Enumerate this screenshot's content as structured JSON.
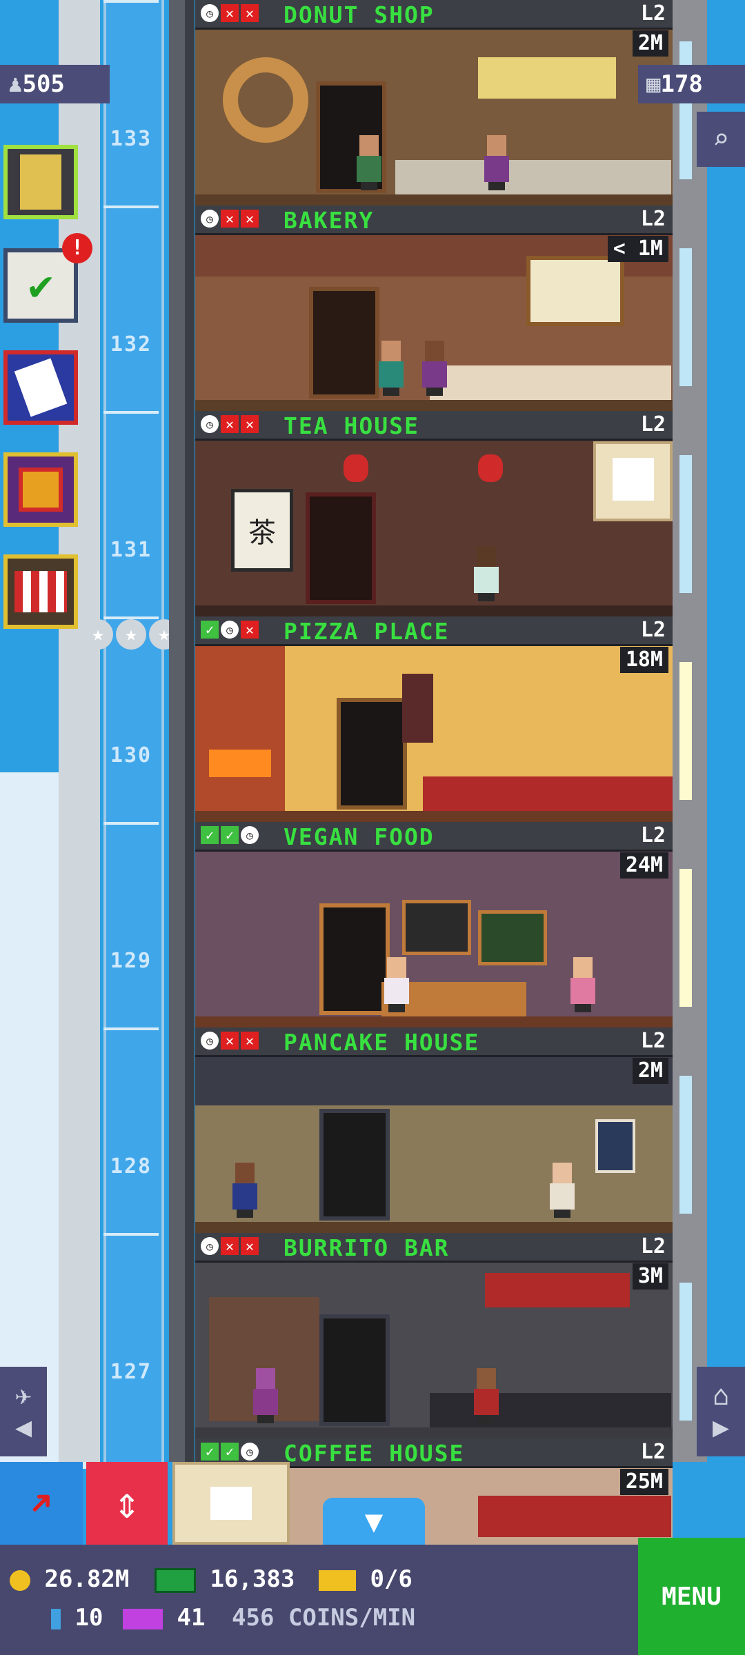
{
  "hud": {
    "population": "505",
    "bux_floors": "178"
  },
  "floors": [
    {
      "name": "DONUT SHOP",
      "level": "L2",
      "price": "2M",
      "status": [
        "clock",
        "x",
        "x"
      ]
    },
    {
      "name": "BAKERY",
      "level": "L2",
      "price": "< 1M",
      "status": [
        "clock",
        "x",
        "x"
      ]
    },
    {
      "name": "TEA HOUSE",
      "level": "L2",
      "price": "",
      "status": [
        "clock",
        "x",
        "x"
      ],
      "sign": "茶"
    },
    {
      "name": "PIZZA PLACE",
      "level": "L2",
      "price": "18M",
      "status": [
        "check",
        "clock",
        "x"
      ]
    },
    {
      "name": "VEGAN FOOD",
      "level": "L2",
      "price": "24M",
      "status": [
        "check",
        "check",
        "clock"
      ]
    },
    {
      "name": "PANCAKE HOUSE",
      "level": "L2",
      "price": "2M",
      "status": [
        "clock",
        "x",
        "x"
      ]
    },
    {
      "name": "BURRITO BAR",
      "level": "L2",
      "price": "3M",
      "status": [
        "clock",
        "x",
        "x"
      ]
    },
    {
      "name": "COFFEE HOUSE",
      "level": "L2",
      "price": "25M",
      "status": [
        "check",
        "check",
        "clock"
      ]
    }
  ],
  "shaft_numbers": [
    "133",
    "132",
    "131",
    "130",
    "129",
    "128",
    "127"
  ],
  "stats": {
    "coins": "26.82M",
    "bux": "16,383",
    "tickets": "0/6",
    "keys": "10",
    "vip": "41",
    "rate": "456 COINS/MIN"
  },
  "menu_label": "MENU",
  "notification_badge": "!",
  "colors": {
    "accent_green": "#38e040",
    "menu_green": "#20b030",
    "alert_red": "#e02020",
    "gold": "#e0c030"
  }
}
